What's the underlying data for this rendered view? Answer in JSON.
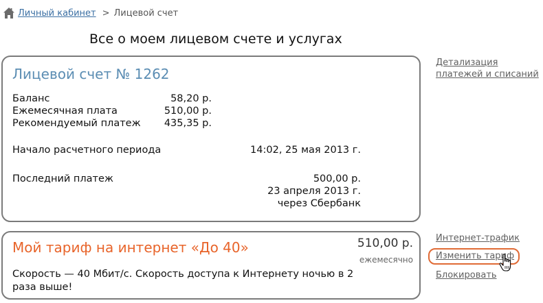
{
  "breadcrumb": {
    "home_icon": "home-icon",
    "link": "Личный кабинет",
    "separator": ">",
    "current": "Лицевой счет"
  },
  "page_title": "Все о моем лицевом счете и услугах",
  "account": {
    "title": "Лицевой счет № 1262",
    "balance_label": "Баланс",
    "balance_value": "58,20 р.",
    "monthly_fee_label": "Ежемесячная плата",
    "monthly_fee_value": "510,00 р.",
    "recommended_label": "Рекомендуемый платеж",
    "recommended_value": "435,35 р.",
    "period_start_label": "Начало расчетного периода",
    "period_start_value": "14:02, 25 мая 2013 г.",
    "last_payment_label": "Последний платеж",
    "last_payment_amount": "500,00 р.",
    "last_payment_date": "23 апреля 2013 г.",
    "last_payment_method": "через Сбербанк"
  },
  "tariff": {
    "title": "Мой тариф на интернет «До 40»",
    "price": "510,00 р.",
    "period": "ежемесячно",
    "description": "Скорость — 40 Мбит/с. Скорость доступа к Интернету ночью в 2 раза выше!"
  },
  "side_links": {
    "details": "Детализация платежей и списаний",
    "traffic": "Интернет-трафик",
    "change_tariff": "Изменить тариф",
    "block": "Блокировать"
  },
  "colors": {
    "account_title": "#5b8db3",
    "tariff_title": "#e8642a",
    "highlight_border": "#e06a35",
    "link": "#3b6fa3"
  }
}
